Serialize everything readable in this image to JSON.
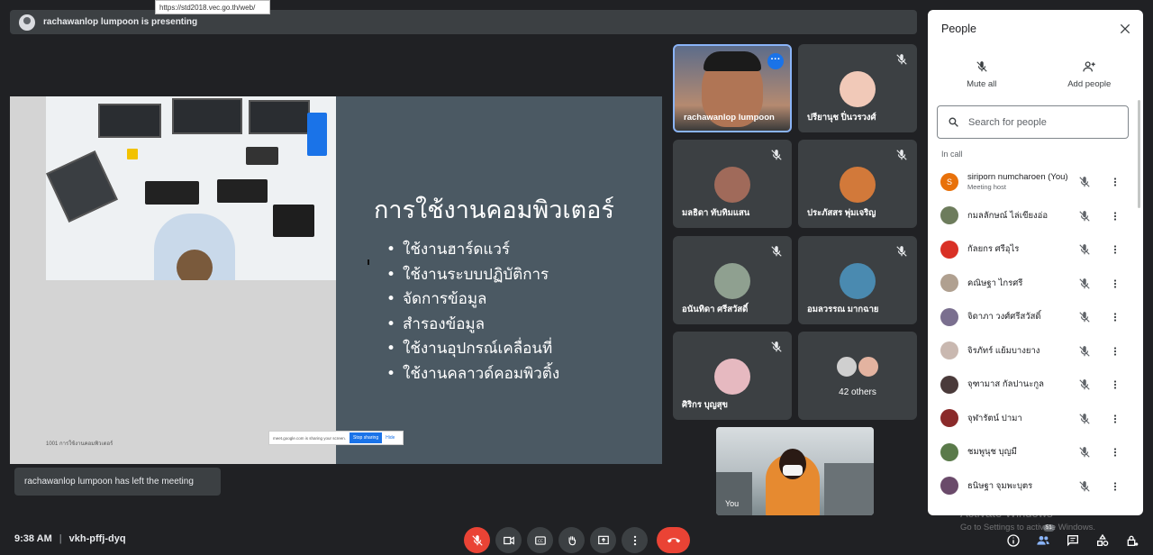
{
  "url_tooltip": "https://std2018.vec.go.th/web/",
  "presenting": "rachawanlop lumpoon is presenting",
  "slide": {
    "title": "การใช้งานคอมพิวเตอร์",
    "bullets": [
      "ใช้งานฮาร์ดแวร์",
      "ใช้งานระบบปฏิบัติการ",
      "จัดการข้อมูล",
      "สำรองข้อมูล",
      "ใช้งานอุปกรณ์เคลื่อนที่",
      "ใช้งานคลาวด์คอมพิวติ้ง"
    ],
    "footer": "1001 การใช้งานคอมพิวเตอร์",
    "share_text": "meet.google.com is sharing your screen.",
    "stop_sharing": "Stop sharing",
    "hide": "Hide"
  },
  "tiles": [
    {
      "name": "rachawanlop lumpoon"
    },
    {
      "name": "ปรียานุช ปิ่นวรวงศ์"
    },
    {
      "name": "มลธิดา ทับทิมแสน"
    },
    {
      "name": "ประภัสสร พุ่มเจริญ"
    },
    {
      "name": "อนันทิดา ศรีสวัสดิ์"
    },
    {
      "name": "อมลวรรณ มากฉาย"
    },
    {
      "name": "ศิริกร บุญสุข"
    }
  ],
  "others": "42 others",
  "self_label": "You",
  "toast": "rachawanlop lumpoon has left the meeting",
  "time": "9:38 AM",
  "meeting_code": "vkh-pffj-dyq",
  "people_badge": "51",
  "people_panel": {
    "title": "People",
    "mute_all": "Mute all",
    "add_people": "Add people",
    "search_placeholder": "Search for people",
    "in_call": "In call",
    "participants": [
      {
        "name": "siriporn numcharoen (You)",
        "sub": "Meeting host",
        "initial": "S",
        "color": "#e8710a"
      },
      {
        "name": "กมลลักษณ์ ไล่เขียงอ่อ",
        "sub": "",
        "initial": "",
        "color": "#6d7c5c"
      },
      {
        "name": "กัลยกร ศรีอุไร",
        "sub": "",
        "initial": "",
        "color": "#d93025"
      },
      {
        "name": "คณิษฐา ไกรศรี",
        "sub": "",
        "initial": "",
        "color": "#b0a090"
      },
      {
        "name": "จิดาภา วงศ์ศรีสวัสดิ์",
        "sub": "",
        "initial": "",
        "color": "#7a6f8f"
      },
      {
        "name": "จิรภัทร์ แย้มบางยาง",
        "sub": "",
        "initial": "",
        "color": "#c9b8b0"
      },
      {
        "name": "จุฑามาส กัลปานะกูล",
        "sub": "",
        "initial": "",
        "color": "#4a3a3a"
      },
      {
        "name": "จุฬารัตน์ ปามา",
        "sub": "",
        "initial": "",
        "color": "#8a2a2a"
      },
      {
        "name": "ชมพูนุช บุญมี",
        "sub": "",
        "initial": "",
        "color": "#5a7a4a"
      },
      {
        "name": "ธนิษฐา จุมพะบุตร",
        "sub": "",
        "initial": "",
        "color": "#6a4a6a"
      }
    ]
  },
  "watermark": {
    "title": "Activate Windows",
    "sub": "Go to Settings to activate Windows."
  }
}
